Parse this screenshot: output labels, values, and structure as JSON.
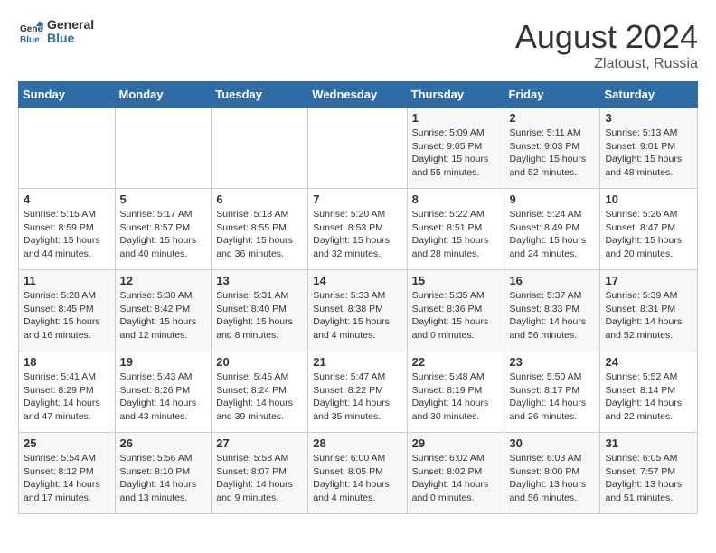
{
  "header": {
    "logo_line1": "General",
    "logo_line2": "Blue",
    "month_year": "August 2024",
    "location": "Zlatoust, Russia"
  },
  "weekdays": [
    "Sunday",
    "Monday",
    "Tuesday",
    "Wednesday",
    "Thursday",
    "Friday",
    "Saturday"
  ],
  "weeks": [
    [
      {
        "day": "",
        "info": ""
      },
      {
        "day": "",
        "info": ""
      },
      {
        "day": "",
        "info": ""
      },
      {
        "day": "",
        "info": ""
      },
      {
        "day": "1",
        "info": "Sunrise: 5:09 AM\nSunset: 9:05 PM\nDaylight: 15 hours\nand 55 minutes."
      },
      {
        "day": "2",
        "info": "Sunrise: 5:11 AM\nSunset: 9:03 PM\nDaylight: 15 hours\nand 52 minutes."
      },
      {
        "day": "3",
        "info": "Sunrise: 5:13 AM\nSunset: 9:01 PM\nDaylight: 15 hours\nand 48 minutes."
      }
    ],
    [
      {
        "day": "4",
        "info": "Sunrise: 5:15 AM\nSunset: 8:59 PM\nDaylight: 15 hours\nand 44 minutes."
      },
      {
        "day": "5",
        "info": "Sunrise: 5:17 AM\nSunset: 8:57 PM\nDaylight: 15 hours\nand 40 minutes."
      },
      {
        "day": "6",
        "info": "Sunrise: 5:18 AM\nSunset: 8:55 PM\nDaylight: 15 hours\nand 36 minutes."
      },
      {
        "day": "7",
        "info": "Sunrise: 5:20 AM\nSunset: 8:53 PM\nDaylight: 15 hours\nand 32 minutes."
      },
      {
        "day": "8",
        "info": "Sunrise: 5:22 AM\nSunset: 8:51 PM\nDaylight: 15 hours\nand 28 minutes."
      },
      {
        "day": "9",
        "info": "Sunrise: 5:24 AM\nSunset: 8:49 PM\nDaylight: 15 hours\nand 24 minutes."
      },
      {
        "day": "10",
        "info": "Sunrise: 5:26 AM\nSunset: 8:47 PM\nDaylight: 15 hours\nand 20 minutes."
      }
    ],
    [
      {
        "day": "11",
        "info": "Sunrise: 5:28 AM\nSunset: 8:45 PM\nDaylight: 15 hours\nand 16 minutes."
      },
      {
        "day": "12",
        "info": "Sunrise: 5:30 AM\nSunset: 8:42 PM\nDaylight: 15 hours\nand 12 minutes."
      },
      {
        "day": "13",
        "info": "Sunrise: 5:31 AM\nSunset: 8:40 PM\nDaylight: 15 hours\nand 8 minutes."
      },
      {
        "day": "14",
        "info": "Sunrise: 5:33 AM\nSunset: 8:38 PM\nDaylight: 15 hours\nand 4 minutes."
      },
      {
        "day": "15",
        "info": "Sunrise: 5:35 AM\nSunset: 8:36 PM\nDaylight: 15 hours\nand 0 minutes."
      },
      {
        "day": "16",
        "info": "Sunrise: 5:37 AM\nSunset: 8:33 PM\nDaylight: 14 hours\nand 56 minutes."
      },
      {
        "day": "17",
        "info": "Sunrise: 5:39 AM\nSunset: 8:31 PM\nDaylight: 14 hours\nand 52 minutes."
      }
    ],
    [
      {
        "day": "18",
        "info": "Sunrise: 5:41 AM\nSunset: 8:29 PM\nDaylight: 14 hours\nand 47 minutes."
      },
      {
        "day": "19",
        "info": "Sunrise: 5:43 AM\nSunset: 8:26 PM\nDaylight: 14 hours\nand 43 minutes."
      },
      {
        "day": "20",
        "info": "Sunrise: 5:45 AM\nSunset: 8:24 PM\nDaylight: 14 hours\nand 39 minutes."
      },
      {
        "day": "21",
        "info": "Sunrise: 5:47 AM\nSunset: 8:22 PM\nDaylight: 14 hours\nand 35 minutes."
      },
      {
        "day": "22",
        "info": "Sunrise: 5:48 AM\nSunset: 8:19 PM\nDaylight: 14 hours\nand 30 minutes."
      },
      {
        "day": "23",
        "info": "Sunrise: 5:50 AM\nSunset: 8:17 PM\nDaylight: 14 hours\nand 26 minutes."
      },
      {
        "day": "24",
        "info": "Sunrise: 5:52 AM\nSunset: 8:14 PM\nDaylight: 14 hours\nand 22 minutes."
      }
    ],
    [
      {
        "day": "25",
        "info": "Sunrise: 5:54 AM\nSunset: 8:12 PM\nDaylight: 14 hours\nand 17 minutes."
      },
      {
        "day": "26",
        "info": "Sunrise: 5:56 AM\nSunset: 8:10 PM\nDaylight: 14 hours\nand 13 minutes."
      },
      {
        "day": "27",
        "info": "Sunrise: 5:58 AM\nSunset: 8:07 PM\nDaylight: 14 hours\nand 9 minutes."
      },
      {
        "day": "28",
        "info": "Sunrise: 6:00 AM\nSunset: 8:05 PM\nDaylight: 14 hours\nand 4 minutes."
      },
      {
        "day": "29",
        "info": "Sunrise: 6:02 AM\nSunset: 8:02 PM\nDaylight: 14 hours\nand 0 minutes."
      },
      {
        "day": "30",
        "info": "Sunrise: 6:03 AM\nSunset: 8:00 PM\nDaylight: 13 hours\nand 56 minutes."
      },
      {
        "day": "31",
        "info": "Sunrise: 6:05 AM\nSunset: 7:57 PM\nDaylight: 13 hours\nand 51 minutes."
      }
    ]
  ]
}
